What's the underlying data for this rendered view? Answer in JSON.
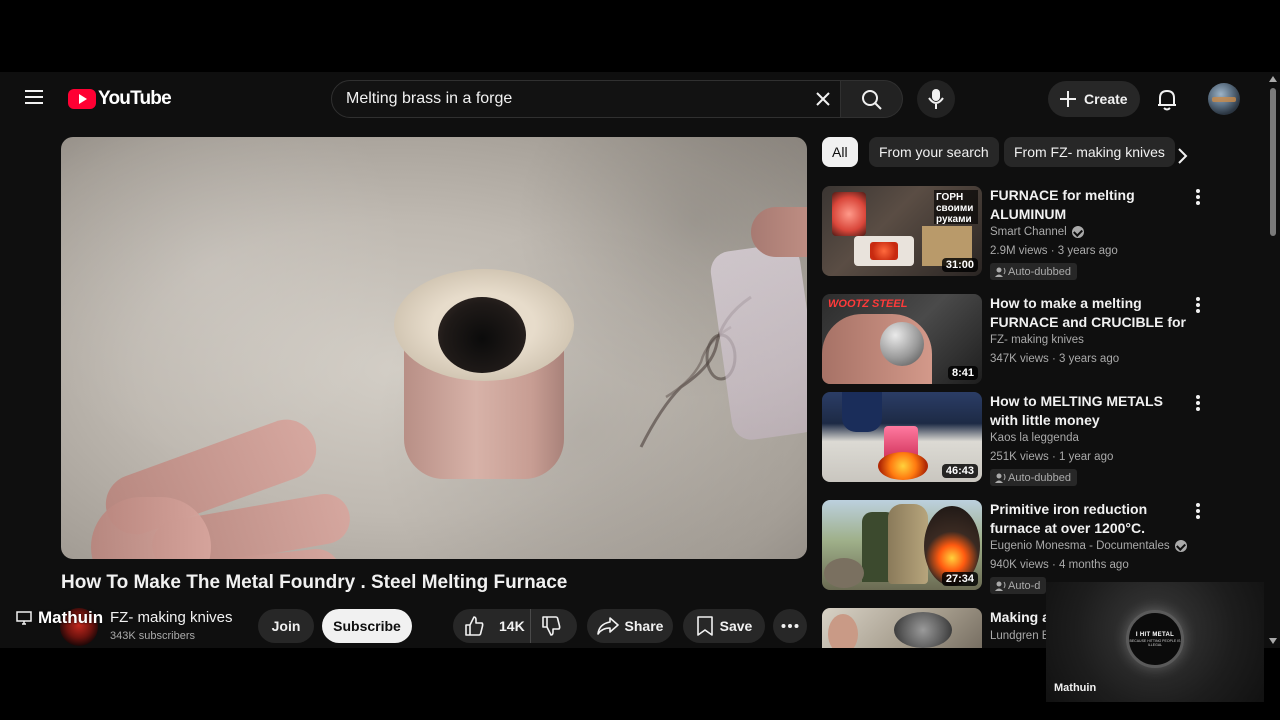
{
  "header": {
    "logo_text": "YouTube",
    "search_value": "Melting brass in a forge",
    "create_label": "Create"
  },
  "video": {
    "title": "How To Make The Metal Foundry . Steel Melting Furnace",
    "overlay_name": "Mathuin",
    "channel_name": "FZ- making knives",
    "subscribers": "343K subscribers",
    "join_label": "Join",
    "subscribe_label": "Subscribe",
    "like_count": "14K",
    "share_label": "Share",
    "save_label": "Save"
  },
  "chips": [
    {
      "label": "All",
      "active": true
    },
    {
      "label": "From your search",
      "active": false
    },
    {
      "label": "From FZ- making knives",
      "active": false
    }
  ],
  "recommendations": [
    {
      "title": "FURNACE for melting ALUMINUM",
      "channel": "Smart Channel",
      "verified": true,
      "meta": "2.9M views · 3 years ago",
      "badge": "Auto-dubbed",
      "duration": "31:00",
      "thumb_text": "ГОРН своими руками"
    },
    {
      "title": "How to make a melting FURNACE and CRUCIBLE for ...",
      "channel": "FZ- making knives",
      "verified": false,
      "meta": "347K views · 3 years ago",
      "badge": "",
      "duration": "8:41",
      "thumb_text": "WOOTZ STEEL"
    },
    {
      "title": "How to MELTING METALS with little money",
      "channel": "Kaos la leggenda",
      "verified": false,
      "meta": "251K views · 1 year ago",
      "badge": "Auto-dubbed",
      "duration": "46:43",
      "thumb_text": ""
    },
    {
      "title": "Primitive iron reduction furnace at over 1200°C. Transforming ...",
      "channel": "Eugenio Monesma - Documentales",
      "verified": true,
      "meta": "940K views · 4 months ago",
      "badge": "Auto-d",
      "duration": "27:34",
      "thumb_text": ""
    },
    {
      "title": "Making a",
      "channel": "Lundgren B",
      "verified": false,
      "meta": "",
      "badge": "",
      "duration": "",
      "thumb_text": ""
    }
  ],
  "pip": {
    "name": "Mathuin",
    "logo_line1": "I HIT METAL",
    "logo_line2": "BECAUSE HITTING PEOPLE IS ILLEGAL"
  },
  "colors": {
    "background": "#0f0f0f",
    "brand_red": "#ff0033",
    "pill": "#272727",
    "text_secondary": "#aaaaaa"
  },
  "icons": [
    "menu-icon",
    "youtube-play-icon",
    "close-icon",
    "search-icon",
    "mic-icon",
    "plus-icon",
    "bell-icon",
    "thumbs-up-icon",
    "thumbs-down-icon",
    "share-icon",
    "bookmark-icon",
    "more-horiz-icon",
    "chevron-right-icon",
    "more-vert-icon",
    "verified-icon",
    "auto-dubbed-icon",
    "desktop-icon"
  ]
}
